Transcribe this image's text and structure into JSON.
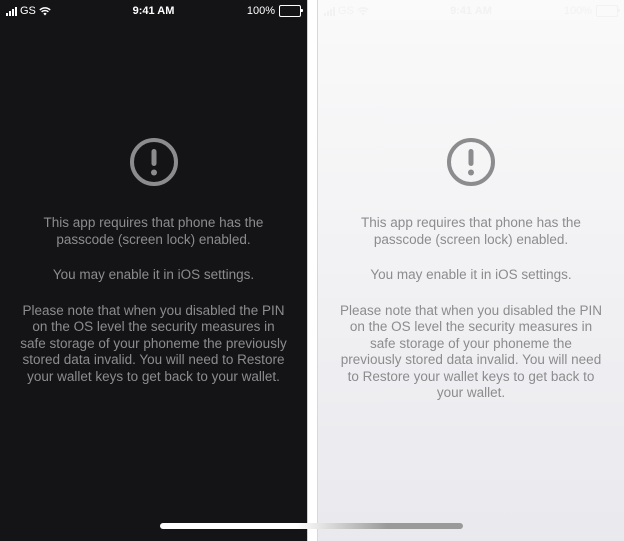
{
  "status_bar": {
    "carrier": "GS",
    "time": "9:41 AM",
    "battery": "100%"
  },
  "message": {
    "icon": "exclamation-circle-icon",
    "paragraph_1": "This app requires that phone has the passcode (screen lock) enabled.",
    "paragraph_2": "You may enable it in iOS settings.",
    "paragraph_3": "Please note that when you disabled the PIN on the OS level the security measures in safe storage of your phoneme the previously stored data invalid. You will need to Restore your wallet keys to get back to your wallet."
  },
  "colors": {
    "dark_background": "#141416",
    "light_background": "#f4f4f6",
    "text": "#8c8c8e"
  }
}
